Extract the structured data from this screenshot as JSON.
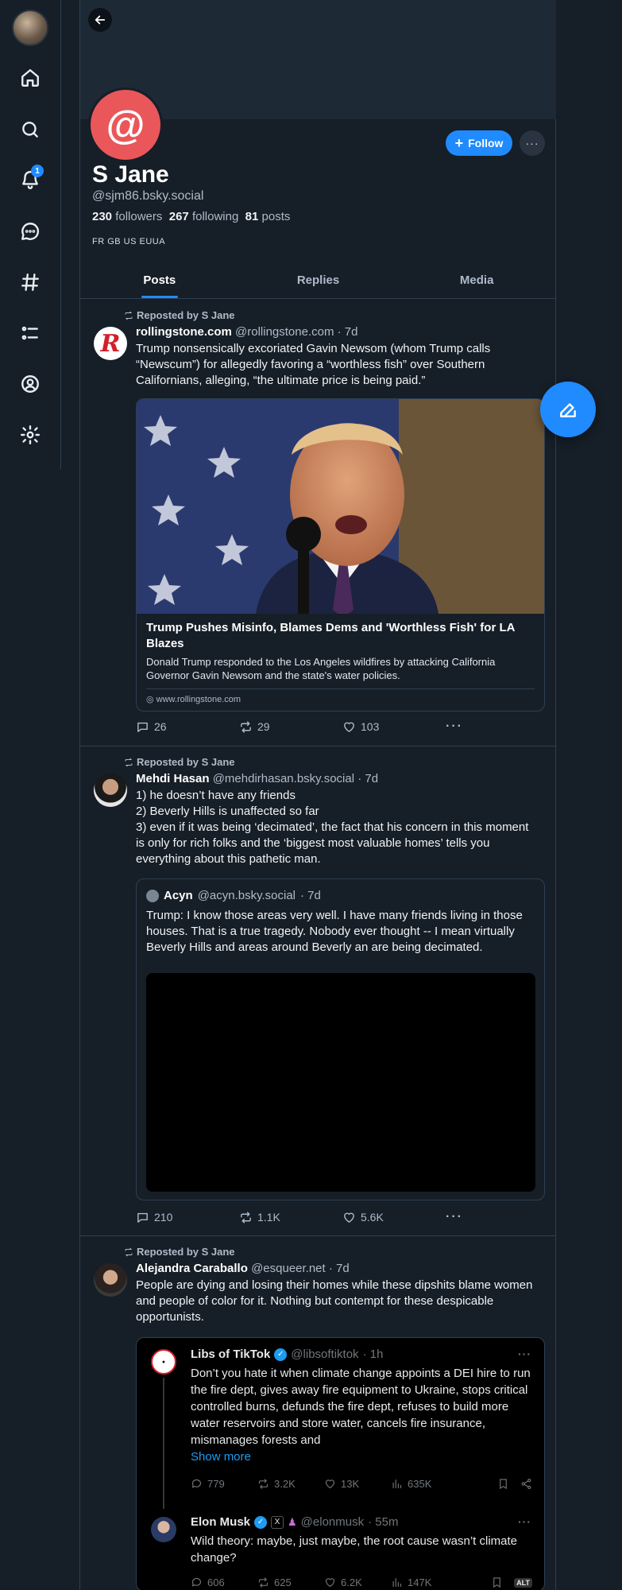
{
  "sidebar": {
    "items": [
      {
        "name": "home-icon"
      },
      {
        "name": "search-icon"
      },
      {
        "name": "bell-icon",
        "badge": "1"
      },
      {
        "name": "chat-icon"
      },
      {
        "name": "hashtag-icon"
      },
      {
        "name": "list-icon"
      },
      {
        "name": "profile-icon"
      },
      {
        "name": "settings-icon"
      }
    ]
  },
  "profile": {
    "avatar_glyph": "@",
    "display_name": "S Jane",
    "handle": "@sjm86.bsky.social",
    "followers_count": "230",
    "followers_label": "followers",
    "following_count": "267",
    "following_label": "following",
    "posts_count": "81",
    "posts_label": "posts",
    "labels": "FR GB US EUUA",
    "follow_label": "Follow",
    "more_label": "···"
  },
  "tabs": [
    {
      "label": "Posts",
      "active": true
    },
    {
      "label": "Replies",
      "active": false
    },
    {
      "label": "Media",
      "active": false
    }
  ],
  "posts": [
    {
      "repost_by": "Reposted by S Jane",
      "author": "rollingstone.com",
      "handle": "@rollingstone.com",
      "time": "· 7d",
      "text": "Trump nonsensically excoriated Gavin Newsom (whom Trump calls “Newscum”) for allegedly favoring a “worthless fish” over Southern Californians, alleging, “the ultimate price is being paid.”",
      "link_card": {
        "title": "Trump Pushes Misinfo, Blames Dems and 'Worthless Fish' for LA Blazes",
        "description": "Donald Trump responded to the Los Angeles wildfires by attacking California Governor Gavin Newsom and the state's water policies.",
        "domain": "www.rollingstone.com"
      },
      "replies": "26",
      "reposts": "29",
      "likes": "103"
    },
    {
      "repost_by": "Reposted by S Jane",
      "author": "Mehdi Hasan",
      "handle": "@mehdirhasan.bsky.social",
      "time": "· 7d",
      "text_lines": [
        "1) he doesn’t have any friends",
        "2) Beverly Hills is unaffected so far",
        "3) even if it was being ‘decimated’, the fact that his concern in this moment is only for rich folks and the ‘biggest most valuable homes’ tells you everything about this pathetic man."
      ],
      "quote": {
        "author": "Acyn",
        "handle": "@acyn.bsky.social",
        "time": "· 7d",
        "text": "Trump: I know those areas very well. I have many friends living in those houses. That is a true tragedy. Nobody ever thought -- I mean virtually Beverly Hills and areas around Beverly an are being decimated."
      },
      "replies": "210",
      "reposts": "1.1K",
      "likes": "5.6K"
    },
    {
      "repost_by": "Reposted by S Jane",
      "author": "Alejandra Caraballo",
      "handle": "@esqueer.net",
      "time": "· 7d",
      "text": "People are dying and losing their homes while these dipshits blame women and people of color for it. Nothing but contempt for these despicable opportunists.",
      "embedded_x": [
        {
          "author": "Libs of TikTok",
          "handle": "@libsoftiktok",
          "time": "· 1h",
          "text": "Don’t you hate it when climate change appoints a DEI hire to run the fire dept, gives away fire equipment to Ukraine, stops critical controlled burns, defunds the fire dept, refuses to build more water reservoirs and store water, cancels fire insurance, mismanages forests and",
          "show_more": "Show more",
          "replies": "779",
          "reposts": "3.2K",
          "likes": "13K",
          "views": "635K"
        },
        {
          "author": "Elon Musk",
          "handle": "@elonmusk",
          "time": "· 55m",
          "text": "Wild theory: maybe, just maybe, the root cause wasn’t climate change?",
          "replies": "606",
          "reposts": "625",
          "likes": "6.2K",
          "views": "147K",
          "alt_label": "ALT"
        }
      ]
    }
  ],
  "colors": {
    "background": "#161e27",
    "accent": "#208bfe",
    "avatar": "#e9575a",
    "border": "#2e4052",
    "x_background": "#000000",
    "x_link": "#1d9bf0"
  }
}
